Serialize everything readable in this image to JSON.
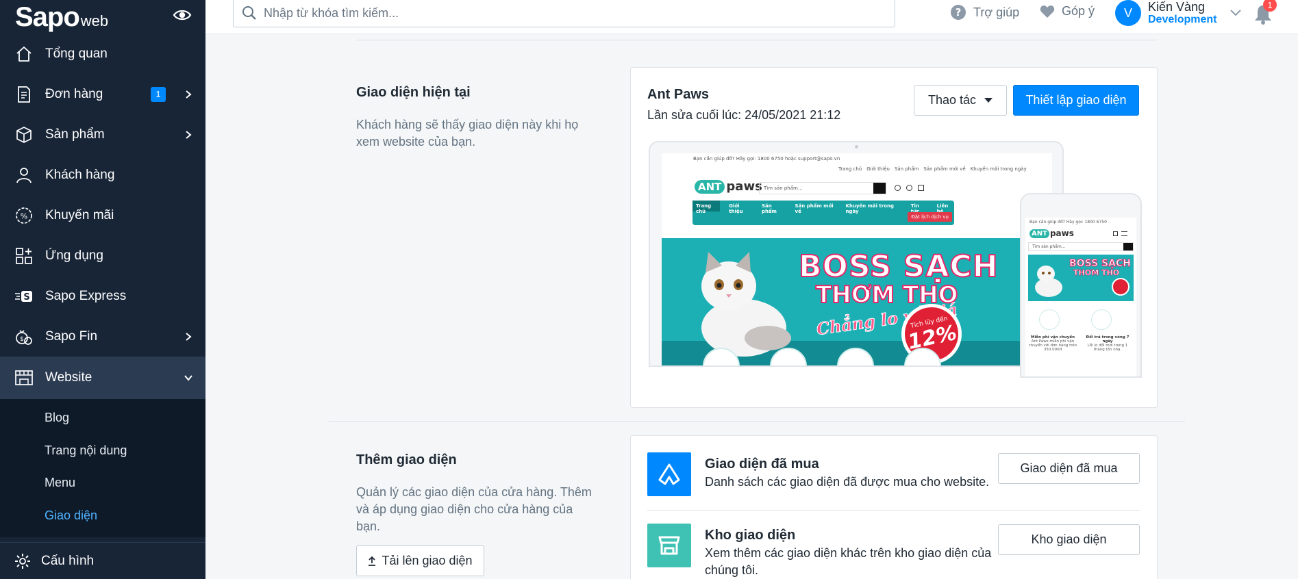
{
  "sidebar": {
    "logo_main": "Sapo",
    "logo_sub": "web",
    "items": [
      {
        "label": "Tổng quan"
      },
      {
        "label": "Đơn hàng",
        "badge": "1"
      },
      {
        "label": "Sản phẩm"
      },
      {
        "label": "Khách hàng"
      },
      {
        "label": "Khuyến mãi"
      },
      {
        "label": "Ứng dụng"
      },
      {
        "label": "Sapo Express"
      },
      {
        "label": "Sapo Fin"
      },
      {
        "label": "Website"
      }
    ],
    "sub_items": [
      {
        "label": "Blog"
      },
      {
        "label": "Trang nội dung"
      },
      {
        "label": "Menu"
      },
      {
        "label": "Giao diện"
      }
    ],
    "config_label": "Cấu hình"
  },
  "topbar": {
    "search_placeholder": "Nhập từ khóa tìm kiếm...",
    "help_label": "Trợ giúp",
    "feedback_label": "Góp ý",
    "user_initial": "V",
    "user_name": "Kiến Vàng",
    "user_role": "Development",
    "notification_count": "1"
  },
  "current_theme": {
    "section_title": "Giao diện hiện tại",
    "section_desc": "Khách hàng sẽ thấy giao diện này khi họ xem website của bạn.",
    "theme_name": "Ant Paws",
    "last_edited": "Lần sửa cuối lúc: 24/05/2021 21:12",
    "actions_label": "Thao tác",
    "customize_label": "Thiết lập giao diện"
  },
  "preview": {
    "topline": "Bạn cần giúp đỡ? Hãy gọi:  1800 6750   hoặc   support@sapo.vn",
    "nav_links": [
      "Trang chủ",
      "Giới thiệu",
      "Sản phẩm",
      "Sản phẩm mới về",
      "Khuyến mãi trong ngày"
    ],
    "brand_ant": "ANT",
    "brand_paws": "paws",
    "search_ph": "Tìm sản phẩm...",
    "menu": [
      "Trang chủ",
      "Giới thiệu",
      "Sản phẩm",
      "Sản phẩm mới về",
      "Khuyến mãi trong ngày",
      "Tin tức",
      "Liên hệ"
    ],
    "booking": "Đặt lịch dịch vụ",
    "banner_line1": "BOSS SẠCH",
    "banner_line2": "THƠM THO",
    "banner_line3": "Chẳng lo về giá",
    "promo_text": "Tích lũy đến",
    "promo_pct": "12%",
    "phone_topline": "Bạn cần giúp đỡ? Hãy gọi:  1800 6750",
    "phone_feat1_title": "Miễn phí vận chuyển",
    "phone_feat1_desc": "Ant Paws miễn phí vận chuyển với đơn hàng trên 350.000đ",
    "phone_feat2_title": "Đổi trả trong vòng 7 ngày",
    "phone_feat2_desc": "Lỗi lo đổi mới trong 1 tháng tồn nhà."
  },
  "add_theme": {
    "section_title": "Thêm giao diện",
    "section_desc": "Quản lý các giao diện của cửa hàng. Thêm và áp dụng giao diện cho cửa hàng của bạn.",
    "upload_label": "Tải lên giao diện",
    "purchased_title": "Giao diện đã mua",
    "purchased_desc": "Danh sách các giao diện đã được mua cho website.",
    "purchased_button": "Giao diện đã mua",
    "store_title": "Kho giao diện",
    "store_desc": "Xem thêm các giao diện khác trên kho giao diện của chúng tôi.",
    "store_button": "Kho giao diện"
  }
}
